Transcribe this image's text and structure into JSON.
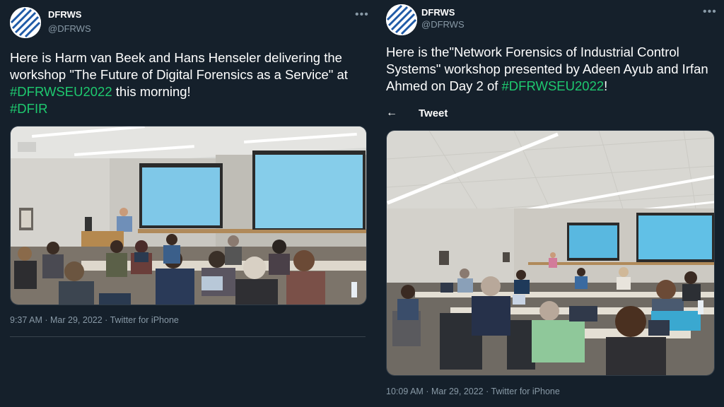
{
  "colors": {
    "background": "#15202b",
    "hashtag": "#1ec96f",
    "muted": "#8899a6"
  },
  "left_tweet": {
    "name": "DFRWS",
    "handle": "@DFRWS",
    "more_icon": "more-dots-icon",
    "text_before": "Here is Harm van Beek and Hans Henseler delivering the workshop \"The Future of Digital Forensics as a Service\" at ",
    "hashtag1": "#DFRWSEU2022",
    "text_after": " this morning!",
    "hashtag2": "#DFIR",
    "time": "9:37 AM",
    "date": "Mar 29, 2022",
    "source": "Twitter for iPhone",
    "sep": "·"
  },
  "right_tweet": {
    "name": "DFRWS",
    "handle": "@DFRWS",
    "more_icon": "more-dots-icon",
    "text_before": "Here is the\"Network Forensics of Industrial Control Systems\" workshop presented by Adeen Ayub and Irfan Ahmed on Day 2 of ",
    "hashtag1": "#DFRWSEU2022",
    "text_after": "!",
    "header_label": "Tweet",
    "back_icon": "back-arrow-icon",
    "time": "10:09 AM",
    "date": "Mar 29, 2022",
    "source": "Twitter for iPhone",
    "sep": "·"
  }
}
